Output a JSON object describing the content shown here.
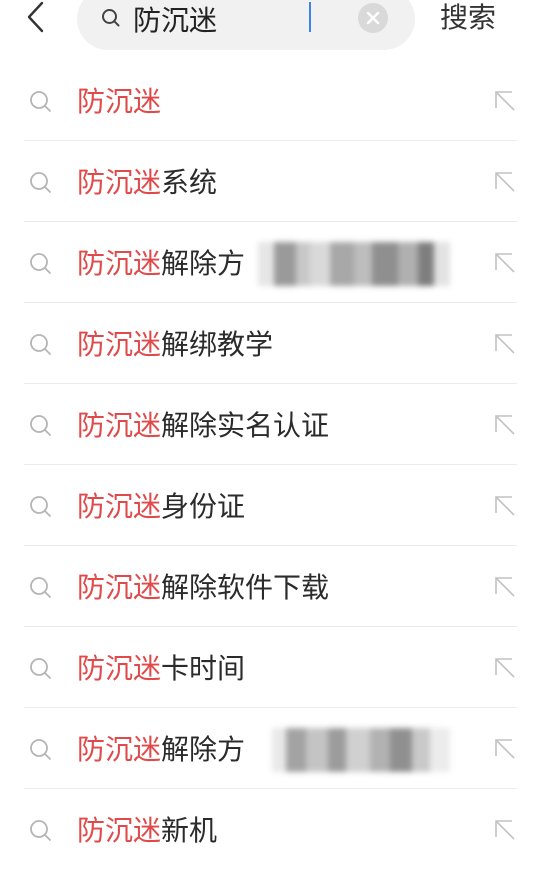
{
  "search": {
    "query": "防沉迷",
    "submit_label": "搜索"
  },
  "suggestions": [
    {
      "match": "防沉迷",
      "rest": ""
    },
    {
      "match": "防沉迷",
      "rest": "系统"
    },
    {
      "match": "防沉迷",
      "rest": "解除方"
    },
    {
      "match": "防沉迷",
      "rest": "解绑教学"
    },
    {
      "match": "防沉迷",
      "rest": "解除实名认证"
    },
    {
      "match": "防沉迷",
      "rest": "身份证"
    },
    {
      "match": "防沉迷",
      "rest": "解除软件下载"
    },
    {
      "match": "防沉迷",
      "rest": "卡时间"
    },
    {
      "match": "防沉迷",
      "rest": "解除方"
    },
    {
      "match": "防沉迷",
      "rest": "新机"
    }
  ],
  "colors": {
    "highlight": "#e04a4a",
    "text": "#2b2b2b",
    "icon": "#b5b5b5",
    "search_bg": "#f1f1f1",
    "caret": "#3a86e8"
  },
  "icons": {
    "back": "chevron-left-icon",
    "search": "search-icon",
    "clear": "clear-circle-icon",
    "fill": "arrow-up-left-icon"
  }
}
